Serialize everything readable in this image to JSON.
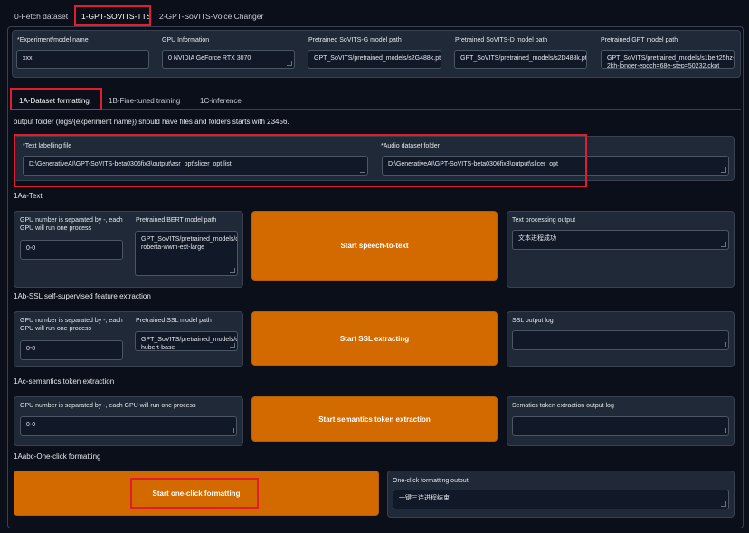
{
  "top_tabs": [
    "0-Fetch dataset",
    "1-GPT-SOVITS-TTS",
    "2-GPT-SoVITS-Voice Changer"
  ],
  "top_tabs_active": 1,
  "config": {
    "experiment_label": "*Experiment/model name",
    "experiment_value": "xxx",
    "gpu_label": "GPU Information",
    "gpu_value": "0 NVIDIA GeForce RTX 3070",
    "sovits_g_label": "Pretrained SoVITS-G model path",
    "sovits_g_value": "GPT_SoVITS/pretrained_models/s2G488k.pth",
    "sovits_d_label": "Pretrained SoVITS-D model path",
    "sovits_d_value": "GPT_SoVITS/pretrained_models/s2D488k.pth",
    "gpt_label": "Pretrained GPT model path",
    "gpt_value": "GPT_SoVITS/pretrained_models/s1bert25hz-2kh-longer-epoch=68e-step=50232.ckpt"
  },
  "sub_tabs": [
    "1A-Dataset formatting",
    "1B-Fine-tuned training",
    "1C-inference"
  ],
  "sub_tabs_active": 0,
  "output_note": "output folder (logs/{experiment name}) should have files and folders starts with 23456.",
  "paths": {
    "text_label": "*Text labelling file",
    "text_value": "D:\\GenerativeAI\\GPT-SoVITS-beta0306fix3\\output\\asr_opt\\slicer_opt.list",
    "audio_label": "*Audio dataset folder",
    "audio_value": "D:\\GenerativeAI\\GPT-SoVITS-beta0306fix3\\output\\slicer_opt"
  },
  "sec_text": {
    "title": "1Aa-Text",
    "gpu_label": "GPU number is separated by -, each GPU will run one process",
    "gpu_value": "0-0",
    "bert_label": "Pretrained BERT model path",
    "bert_value": "GPT_SoVITS/pretrained_models/chinese-roberta-wwm-ext-large",
    "button": "Start speech-to-text",
    "out_label": "Text processing output",
    "out_value": "文本进程成功"
  },
  "sec_ssl": {
    "title": "1Ab-SSL self-supervised feature extraction",
    "gpu_label": "GPU number is separated by -, each GPU will run one process",
    "gpu_value": "0-0",
    "ssl_label": "Pretrained SSL model path",
    "ssl_value": "GPT_SoVITS/pretrained_models/chinese-hubert-base",
    "button": "Start SSL extracting",
    "out_label": "SSL output log",
    "out_value": ""
  },
  "sec_sem": {
    "title": "1Ac-semantics token extraction",
    "gpu_label": "GPU number is separated by -, each GPU will run one process",
    "gpu_value": "0-0",
    "button": "Start semantics token extraction",
    "out_label": "Sematics token extraction output log",
    "out_value": ""
  },
  "sec_one": {
    "title": "1Aabc-One-click formatting",
    "button": "Start one-click formatting",
    "out_label": "One-click formatting output",
    "out_value": "一键三连进程结束"
  },
  "colors": {
    "background": "#0b0f19",
    "panel": "#1f2937",
    "accent_button": "#d26a00",
    "highlight": "#e11d2e"
  }
}
